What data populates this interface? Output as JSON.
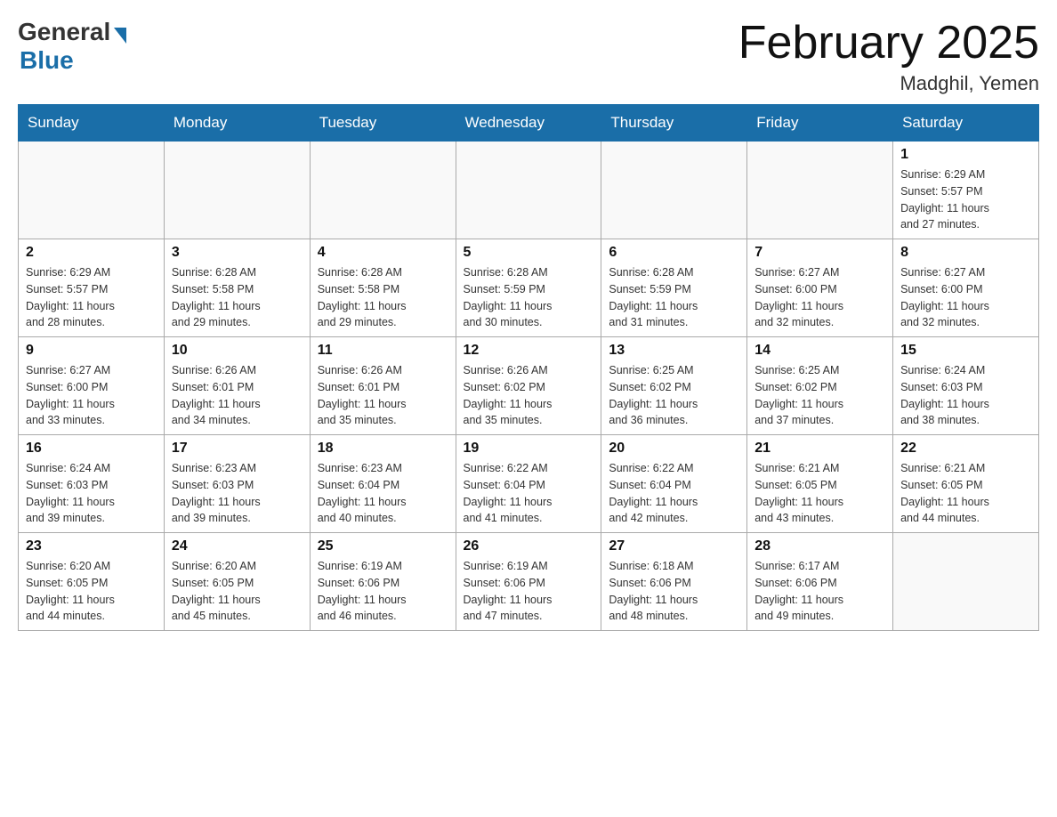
{
  "header": {
    "logo": {
      "general": "General",
      "blue": "Blue"
    },
    "title": "February 2025",
    "subtitle": "Madghil, Yemen"
  },
  "days_of_week": [
    "Sunday",
    "Monday",
    "Tuesday",
    "Wednesday",
    "Thursday",
    "Friday",
    "Saturday"
  ],
  "weeks": [
    [
      {
        "day": "",
        "empty": true
      },
      {
        "day": "",
        "empty": true
      },
      {
        "day": "",
        "empty": true
      },
      {
        "day": "",
        "empty": true
      },
      {
        "day": "",
        "empty": true
      },
      {
        "day": "",
        "empty": true
      },
      {
        "day": "1",
        "sunrise": "6:29 AM",
        "sunset": "5:57 PM",
        "daylight": "11 hours and 27 minutes."
      }
    ],
    [
      {
        "day": "2",
        "sunrise": "6:29 AM",
        "sunset": "5:57 PM",
        "daylight": "11 hours and 28 minutes."
      },
      {
        "day": "3",
        "sunrise": "6:28 AM",
        "sunset": "5:58 PM",
        "daylight": "11 hours and 29 minutes."
      },
      {
        "day": "4",
        "sunrise": "6:28 AM",
        "sunset": "5:58 PM",
        "daylight": "11 hours and 29 minutes."
      },
      {
        "day": "5",
        "sunrise": "6:28 AM",
        "sunset": "5:59 PM",
        "daylight": "11 hours and 30 minutes."
      },
      {
        "day": "6",
        "sunrise": "6:28 AM",
        "sunset": "5:59 PM",
        "daylight": "11 hours and 31 minutes."
      },
      {
        "day": "7",
        "sunrise": "6:27 AM",
        "sunset": "6:00 PM",
        "daylight": "11 hours and 32 minutes."
      },
      {
        "day": "8",
        "sunrise": "6:27 AM",
        "sunset": "6:00 PM",
        "daylight": "11 hours and 32 minutes."
      }
    ],
    [
      {
        "day": "9",
        "sunrise": "6:27 AM",
        "sunset": "6:00 PM",
        "daylight": "11 hours and 33 minutes."
      },
      {
        "day": "10",
        "sunrise": "6:26 AM",
        "sunset": "6:01 PM",
        "daylight": "11 hours and 34 minutes."
      },
      {
        "day": "11",
        "sunrise": "6:26 AM",
        "sunset": "6:01 PM",
        "daylight": "11 hours and 35 minutes."
      },
      {
        "day": "12",
        "sunrise": "6:26 AM",
        "sunset": "6:02 PM",
        "daylight": "11 hours and 35 minutes."
      },
      {
        "day": "13",
        "sunrise": "6:25 AM",
        "sunset": "6:02 PM",
        "daylight": "11 hours and 36 minutes."
      },
      {
        "day": "14",
        "sunrise": "6:25 AM",
        "sunset": "6:02 PM",
        "daylight": "11 hours and 37 minutes."
      },
      {
        "day": "15",
        "sunrise": "6:24 AM",
        "sunset": "6:03 PM",
        "daylight": "11 hours and 38 minutes."
      }
    ],
    [
      {
        "day": "16",
        "sunrise": "6:24 AM",
        "sunset": "6:03 PM",
        "daylight": "11 hours and 39 minutes."
      },
      {
        "day": "17",
        "sunrise": "6:23 AM",
        "sunset": "6:03 PM",
        "daylight": "11 hours and 39 minutes."
      },
      {
        "day": "18",
        "sunrise": "6:23 AM",
        "sunset": "6:04 PM",
        "daylight": "11 hours and 40 minutes."
      },
      {
        "day": "19",
        "sunrise": "6:22 AM",
        "sunset": "6:04 PM",
        "daylight": "11 hours and 41 minutes."
      },
      {
        "day": "20",
        "sunrise": "6:22 AM",
        "sunset": "6:04 PM",
        "daylight": "11 hours and 42 minutes."
      },
      {
        "day": "21",
        "sunrise": "6:21 AM",
        "sunset": "6:05 PM",
        "daylight": "11 hours and 43 minutes."
      },
      {
        "day": "22",
        "sunrise": "6:21 AM",
        "sunset": "6:05 PM",
        "daylight": "11 hours and 44 minutes."
      }
    ],
    [
      {
        "day": "23",
        "sunrise": "6:20 AM",
        "sunset": "6:05 PM",
        "daylight": "11 hours and 44 minutes."
      },
      {
        "day": "24",
        "sunrise": "6:20 AM",
        "sunset": "6:05 PM",
        "daylight": "11 hours and 45 minutes."
      },
      {
        "day": "25",
        "sunrise": "6:19 AM",
        "sunset": "6:06 PM",
        "daylight": "11 hours and 46 minutes."
      },
      {
        "day": "26",
        "sunrise": "6:19 AM",
        "sunset": "6:06 PM",
        "daylight": "11 hours and 47 minutes."
      },
      {
        "day": "27",
        "sunrise": "6:18 AM",
        "sunset": "6:06 PM",
        "daylight": "11 hours and 48 minutes."
      },
      {
        "day": "28",
        "sunrise": "6:17 AM",
        "sunset": "6:06 PM",
        "daylight": "11 hours and 49 minutes."
      },
      {
        "day": "",
        "empty": true
      }
    ]
  ],
  "labels": {
    "sunrise": "Sunrise:",
    "sunset": "Sunset:",
    "daylight": "Daylight:"
  }
}
